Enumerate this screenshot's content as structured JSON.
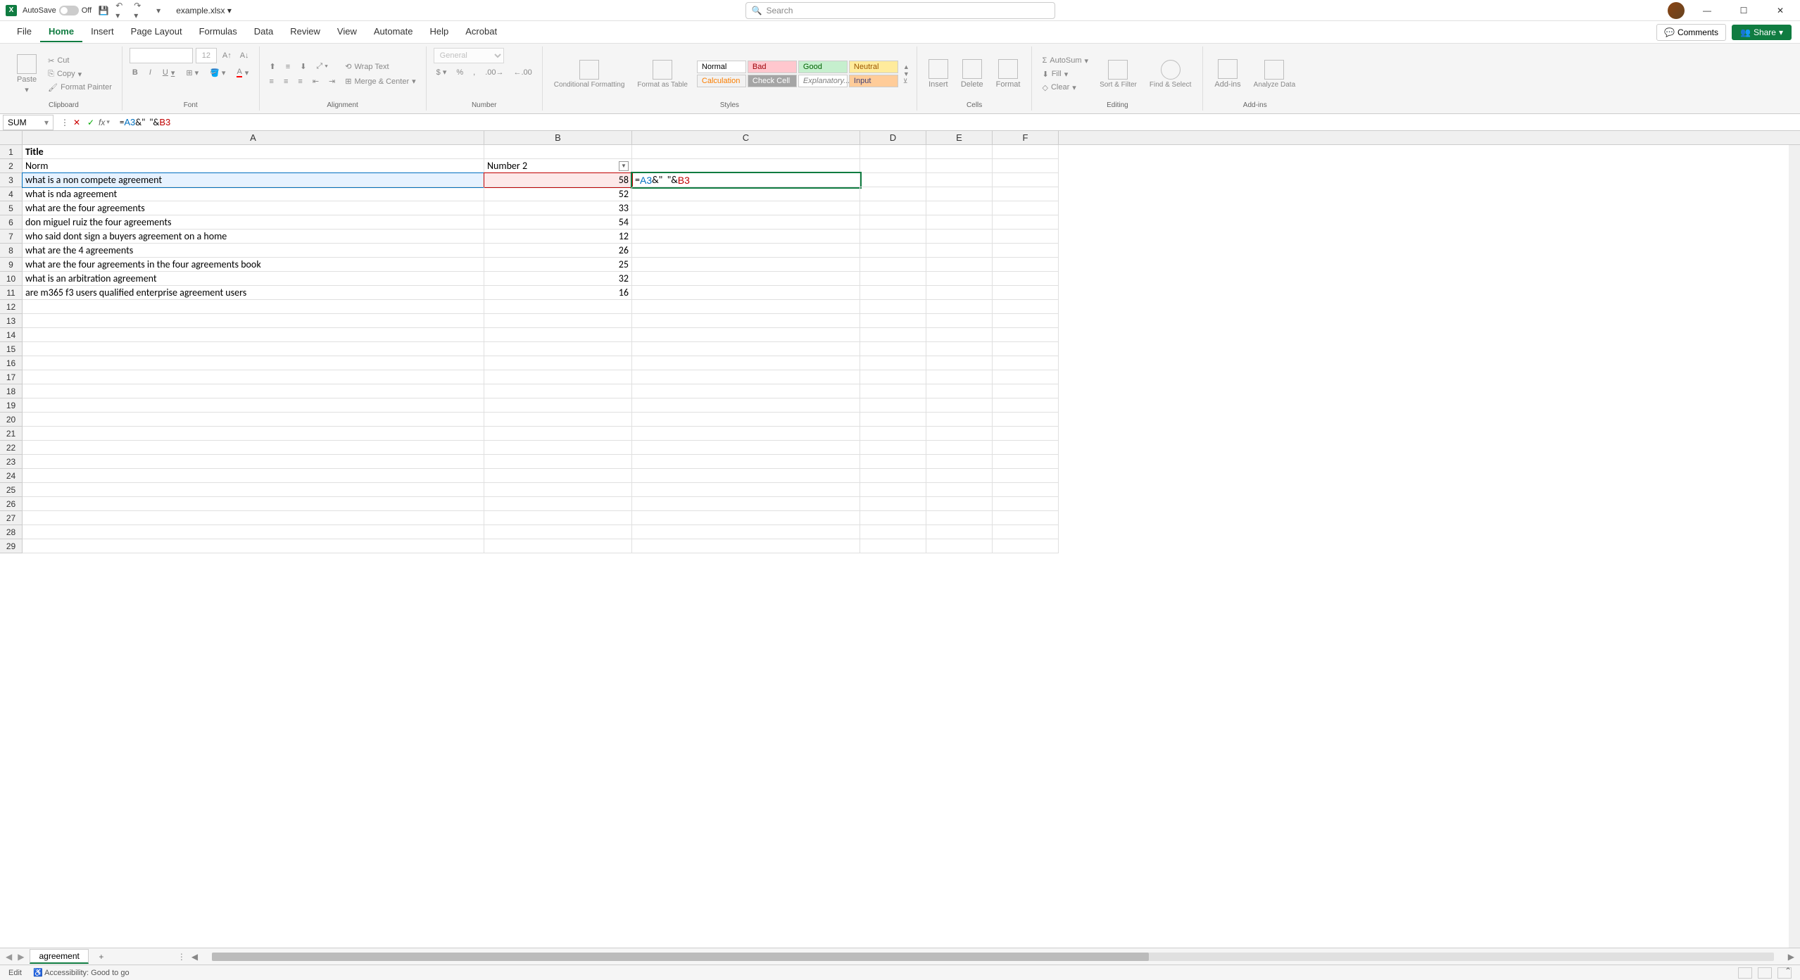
{
  "titleBar": {
    "autoSave": "AutoSave",
    "autoSaveState": "Off",
    "filename": "example.xlsx",
    "searchPlaceholder": "Search"
  },
  "windowControls": {
    "minimize": "—",
    "maximize": "☐",
    "close": "✕"
  },
  "menuTabs": [
    "File",
    "Home",
    "Insert",
    "Page Layout",
    "Formulas",
    "Data",
    "Review",
    "View",
    "Automate",
    "Help",
    "Acrobat"
  ],
  "activeTab": "Home",
  "commentsLabel": "Comments",
  "shareLabel": "Share",
  "ribbon": {
    "clipboard": {
      "label": "Clipboard",
      "paste": "Paste",
      "cut": "Cut",
      "copy": "Copy",
      "formatPainter": "Format Painter"
    },
    "font": {
      "label": "Font",
      "size": "12",
      "bold": "B",
      "italic": "I",
      "underline": "U"
    },
    "alignment": {
      "label": "Alignment",
      "wrapText": "Wrap Text",
      "mergeCenter": "Merge & Center"
    },
    "number": {
      "label": "Number",
      "format": "General"
    },
    "styles": {
      "label": "Styles",
      "conditional": "Conditional Formatting",
      "formatAs": "Format as Table",
      "cells": [
        "Normal",
        "Bad",
        "Good",
        "Neutral",
        "Calculation",
        "Check Cell",
        "Explanatory...",
        "Input"
      ]
    },
    "cells": {
      "label": "Cells",
      "insert": "Insert",
      "delete": "Delete",
      "format": "Format"
    },
    "editing": {
      "label": "Editing",
      "autoSum": "AutoSum",
      "fill": "Fill",
      "clear": "Clear",
      "sortFilter": "Sort & Filter",
      "findSelect": "Find & Select"
    },
    "addins": {
      "label": "Add-ins",
      "addins": "Add-ins",
      "analyze": "Analyze Data"
    }
  },
  "formulaBar": {
    "nameBox": "SUM",
    "formula": "=A3&\"  \"&B3",
    "refA": "A3",
    "refB": "B3"
  },
  "columns": [
    "A",
    "B",
    "C",
    "D",
    "E",
    "F"
  ],
  "rowCount": 29,
  "sheet": {
    "headers": {
      "A1": "Title",
      "A2": "Norm",
      "B2": "Number 2"
    },
    "rows": [
      {
        "title": "what is a non compete agreement",
        "num": 58
      },
      {
        "title": "what is nda agreement",
        "num": 52
      },
      {
        "title": "what are the four agreements",
        "num": 33
      },
      {
        "title": "don miguel ruiz the four agreements",
        "num": 54
      },
      {
        "title": "who said dont sign a buyers agreement on a home",
        "num": 12
      },
      {
        "title": "what are the 4 agreements",
        "num": 26
      },
      {
        "title": "what are the four agreements in the four agreements book",
        "num": 25
      },
      {
        "title": "what is an arbitration agreement",
        "num": 32
      },
      {
        "title": "are m365 f3 users qualified enterprise agreement users",
        "num": 16
      }
    ],
    "editCell": {
      "ref": "C3",
      "display": "=A3&\"  \"&B3"
    }
  },
  "sheetTabs": {
    "active": "agreement"
  },
  "statusBar": {
    "mode": "Edit",
    "accessibility": "Accessibility: Good to go"
  }
}
